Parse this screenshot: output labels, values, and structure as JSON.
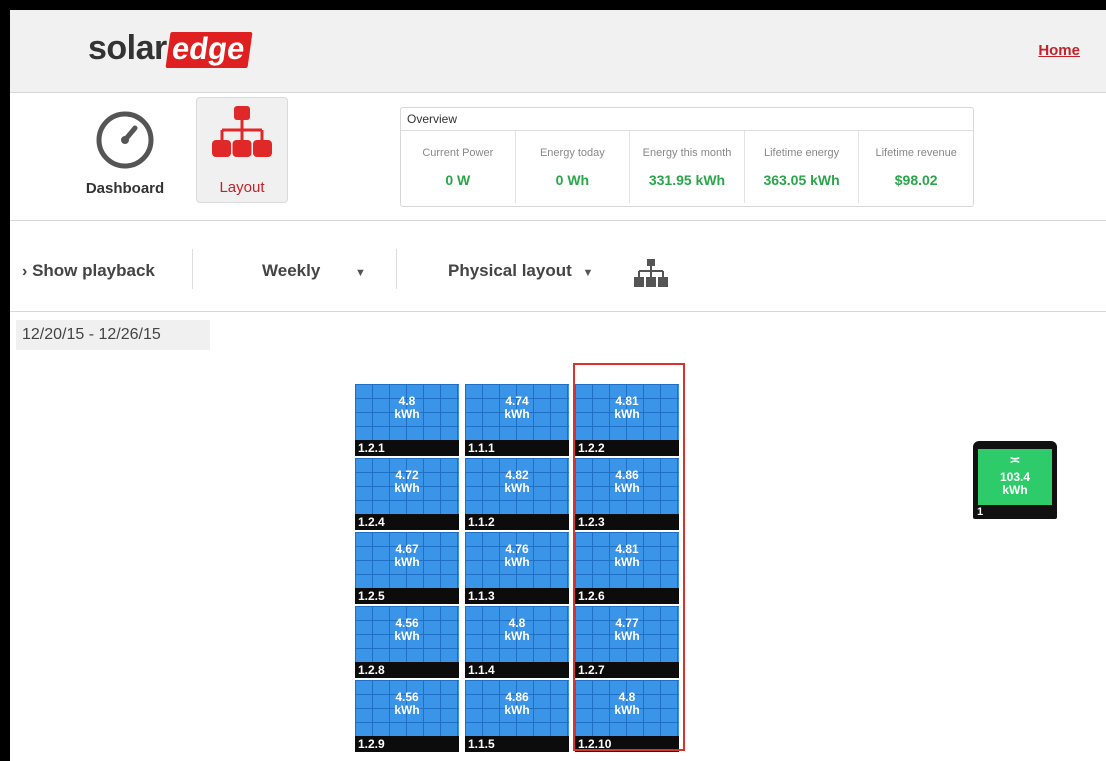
{
  "header": {
    "logo_left": "solar",
    "logo_right": "edge",
    "home_label": "Home"
  },
  "nav": {
    "dashboard_label": "Dashboard",
    "layout_label": "Layout"
  },
  "overview": {
    "title": "Overview",
    "metrics": [
      {
        "label": "Current Power",
        "value": "0 W"
      },
      {
        "label": "Energy today",
        "value": "0 Wh"
      },
      {
        "label": "Energy this month",
        "value": "331.95 kWh"
      },
      {
        "label": "Lifetime energy",
        "value": "363.05 kWh"
      },
      {
        "label": "Lifetime revenue",
        "value": "$98.02"
      }
    ]
  },
  "controls": {
    "playback_label": "Show playback",
    "period_label": "Weekly",
    "layout_view_label": "Physical layout"
  },
  "date_range": "12/20/15 - 12/26/15",
  "panels": [
    {
      "id": "1.2.1",
      "value": "4.8",
      "unit": "kWh"
    },
    {
      "id": "1.1.1",
      "value": "4.74",
      "unit": "kWh"
    },
    {
      "id": "1.2.2",
      "value": "4.81",
      "unit": "kWh"
    },
    {
      "id": "1.2.4",
      "value": "4.72",
      "unit": "kWh"
    },
    {
      "id": "1.1.2",
      "value": "4.82",
      "unit": "kWh"
    },
    {
      "id": "1.2.3",
      "value": "4.86",
      "unit": "kWh"
    },
    {
      "id": "1.2.5",
      "value": "4.67",
      "unit": "kWh"
    },
    {
      "id": "1.1.3",
      "value": "4.76",
      "unit": "kWh"
    },
    {
      "id": "1.2.6",
      "value": "4.81",
      "unit": "kWh"
    },
    {
      "id": "1.2.8",
      "value": "4.56",
      "unit": "kWh"
    },
    {
      "id": "1.1.4",
      "value": "4.8",
      "unit": "kWh"
    },
    {
      "id": "1.2.7",
      "value": "4.77",
      "unit": "kWh"
    },
    {
      "id": "1.2.9",
      "value": "4.56",
      "unit": "kWh"
    },
    {
      "id": "1.1.5",
      "value": "4.86",
      "unit": "kWh"
    },
    {
      "id": "1.2.10",
      "value": "4.8",
      "unit": "kWh"
    }
  ],
  "inverter": {
    "id": "1",
    "value": "103.4",
    "unit": "kWh"
  },
  "colors": {
    "brand_red": "#e02020",
    "panel_blue": "#2f8ae0",
    "inverter_green": "#2ecb6a",
    "value_green": "#2aa54a",
    "highlight_red": "#d9342b"
  }
}
